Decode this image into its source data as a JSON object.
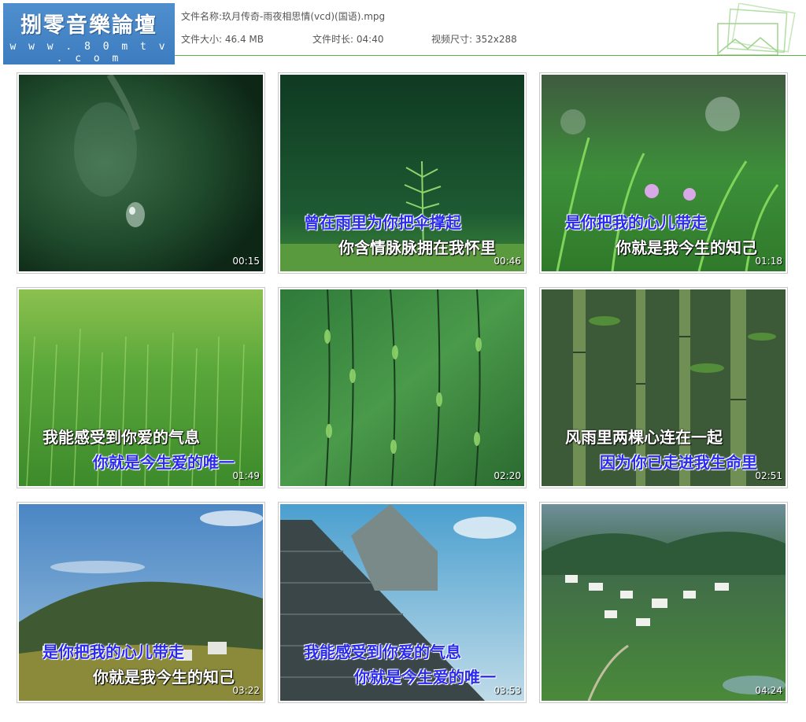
{
  "header": {
    "logo_title": "捌零音樂論壇",
    "logo_url": "w w w . 8 0 m t v . c o m",
    "file_name_label": "文件名称:",
    "file_name": "玖月传奇-雨夜相思情(vcd)(国语).mpg",
    "file_size_label": "文件大小:",
    "file_size": "46.4 MB",
    "duration_label": "文件时长:",
    "duration": "04:40",
    "resolution_label": "视频尺寸:",
    "resolution": "352x288"
  },
  "thumbnails": [
    {
      "timestamp": "00:15",
      "line1": "",
      "line2": ""
    },
    {
      "timestamp": "00:46",
      "line1": "曾在雨里为你把伞撑起",
      "line2": "你含情脉脉拥在我怀里"
    },
    {
      "timestamp": "01:18",
      "line1": "是你把我的心儿带走",
      "line2": "你就是我今生的知己"
    },
    {
      "timestamp": "01:49",
      "line1": "我能感受到你爱的气息",
      "line2": "你就是今生爱的唯一"
    },
    {
      "timestamp": "02:20",
      "line1": "",
      "line2": ""
    },
    {
      "timestamp": "02:51",
      "line1": "风雨里两棵心连在一起",
      "line2": "因为你已走进我生命里"
    },
    {
      "timestamp": "03:22",
      "line1": "是你把我的心儿带走",
      "line2": "你就是我今生的知己"
    },
    {
      "timestamp": "03:53",
      "line1": "我能感受到你爱的气息",
      "line2": "你就是今生爱的唯一"
    },
    {
      "timestamp": "04:24",
      "line1": "",
      "line2": ""
    }
  ]
}
